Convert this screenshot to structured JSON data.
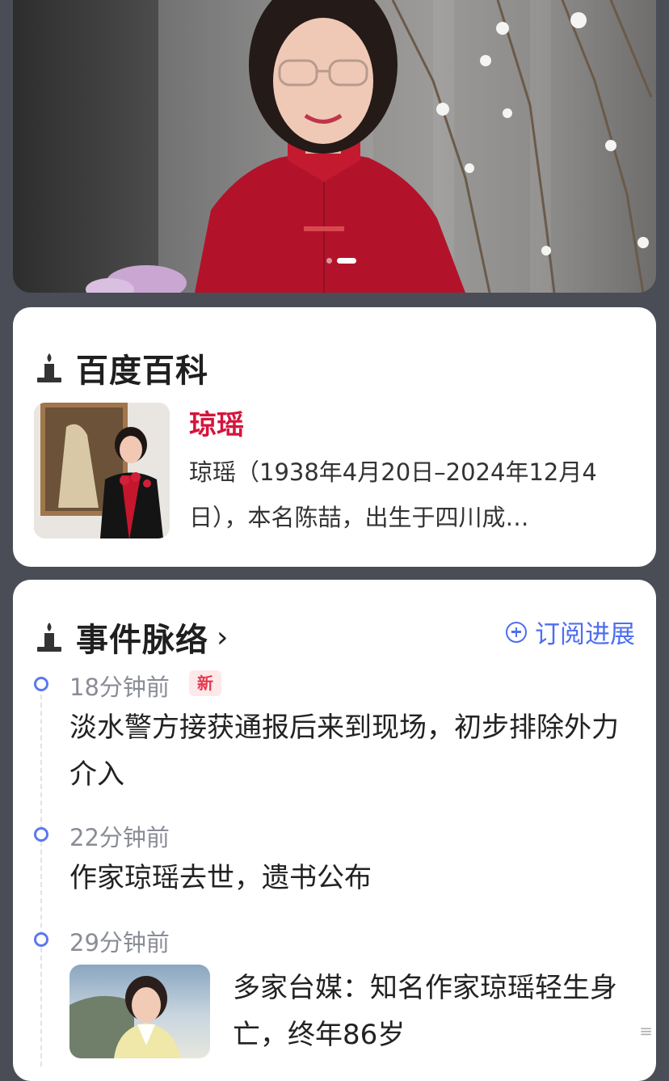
{
  "hero": {
    "image_alt": "人物照片",
    "carousel_total": 2,
    "carousel_active": 1
  },
  "baike": {
    "section_title": "百度百科",
    "name": "琼瑶",
    "description": "琼瑶（1938年4月20日–2024年12月4日），本名陈喆，出生于四川成…"
  },
  "events": {
    "section_title": "事件脉络",
    "subscribe_label": "订阅进展",
    "items": [
      {
        "time": "18分钟前",
        "badge": "新",
        "text": "淡水警方接获通报后来到现场，初步排除外力介入"
      },
      {
        "time": "22分钟前",
        "text": "作家琼瑶去世，遗书公布"
      },
      {
        "time": "29分钟前",
        "text": "多家台媒：知名作家琼瑶轻生身亡，终年86岁",
        "extra": "≡"
      }
    ]
  },
  "colors": {
    "accent_blue": "#4e6ef2",
    "name_red": "#d6143c",
    "badge_red": "#e5394f",
    "background": "#4a4d55"
  }
}
